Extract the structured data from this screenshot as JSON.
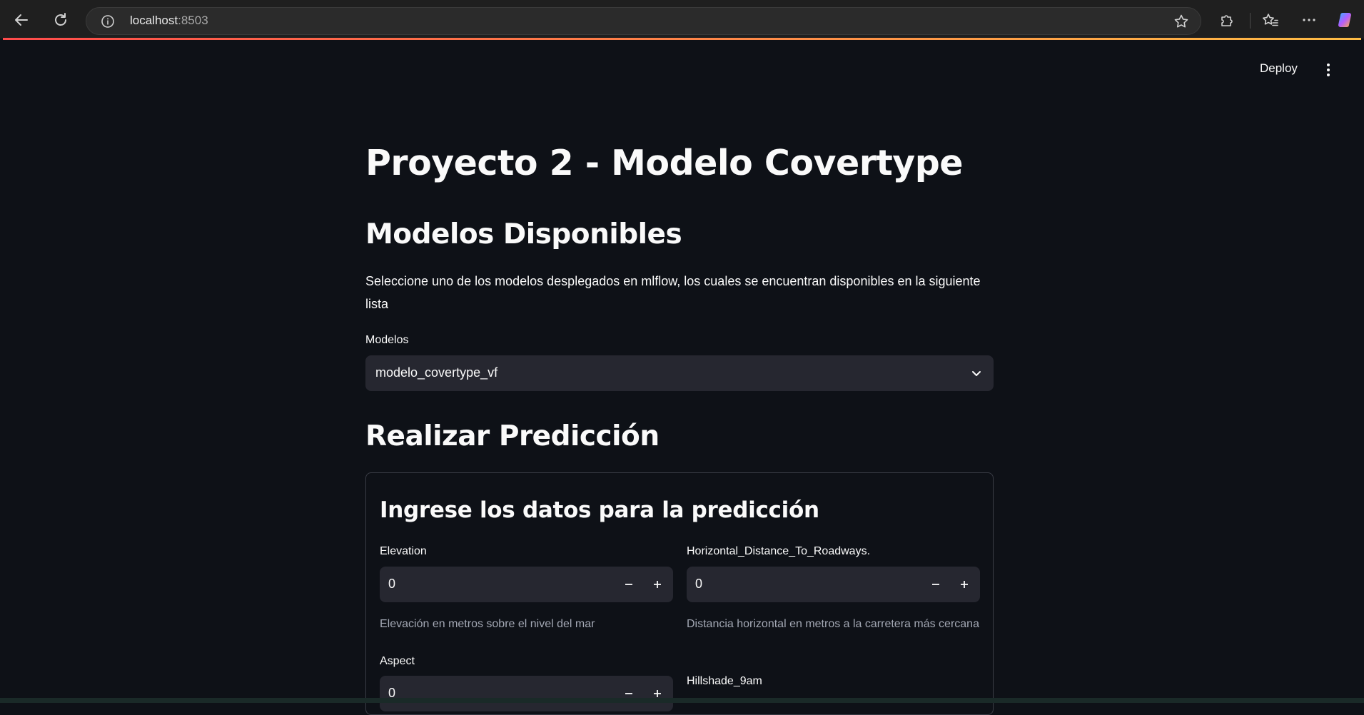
{
  "browser": {
    "url_host": "localhost",
    "url_port": ":8503"
  },
  "header": {
    "deploy_label": "Deploy"
  },
  "main": {
    "title": "Proyecto 2 - Modelo Covertype",
    "models_heading": "Modelos Disponibles",
    "models_description": "Seleccione uno de los modelos desplegados en mlflow, los cuales se encuentran disponibles en la siguiente lista",
    "models_select_label": "Modelos",
    "models_select_value": "modelo_covertype_vf",
    "prediction_heading": "Realizar Predicción",
    "form": {
      "title": "Ingrese los datos para la predicción",
      "fields": {
        "elevation": {
          "label": "Elevation",
          "value": "0",
          "help": "Elevación en metros sobre el nivel del mar"
        },
        "roadways": {
          "label": "Horizontal_Distance_To_Roadways.",
          "value": "0",
          "help": "Distancia horizontal en metros a la carretera más cercana"
        },
        "aspect": {
          "label": "Aspect",
          "value": "0"
        },
        "hillshade": {
          "label": "Hillshade_9am"
        }
      }
    }
  },
  "icons": {
    "back": "arrow-left-icon",
    "reload": "reload-icon",
    "info": "info-icon",
    "favorite": "star-icon",
    "extensions": "puzzle-icon",
    "favorites": "favorites-icon",
    "more": "more-icon",
    "copilot": "copilot-icon"
  },
  "colors": {
    "background": "#0e1117",
    "input_bg": "#262730",
    "accent_start": "#ff4b4b",
    "accent_end": "#ffbd45"
  }
}
